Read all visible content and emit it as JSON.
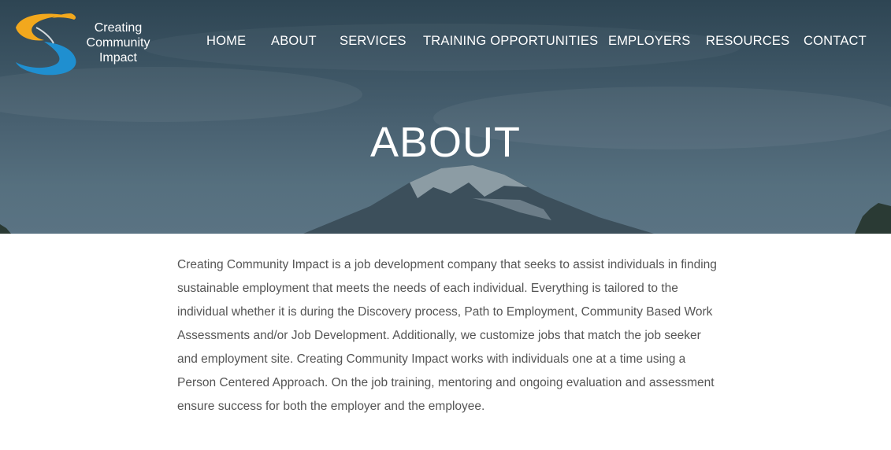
{
  "brand": {
    "line1": "Creating",
    "line2": "Community",
    "line3": "Impact"
  },
  "nav": {
    "items": [
      "HOME",
      "ABOUT",
      "SERVICES",
      "TRAINING OPPORTUNITIES",
      "EMPLOYERS",
      "RESOURCES",
      "CONTACT"
    ]
  },
  "hero": {
    "title": "ABOUT"
  },
  "main": {
    "paragraph": "Creating Community Impact is a job development company that seeks to assist individuals in finding sustainable employment that meets the needs of each individual. Everything is tailored to the individual whether it is during the Discovery process, Path to Employment, Community Based Work Assessments and/or Job Development. Additionally, we customize jobs that match the job seeker and employment site. Creating Community Impact works with individuals one at a time using a Person Centered Approach. On the job training, mentoring and ongoing evaluation and assessment ensure success for both the employer and the employee."
  },
  "colors": {
    "logo_orange": "#f2a81d",
    "logo_blue": "#1f8fd0",
    "hero_overlay": "#3a5261",
    "text": "#555555"
  },
  "icons": {
    "logo": "swirl-logo-icon"
  }
}
